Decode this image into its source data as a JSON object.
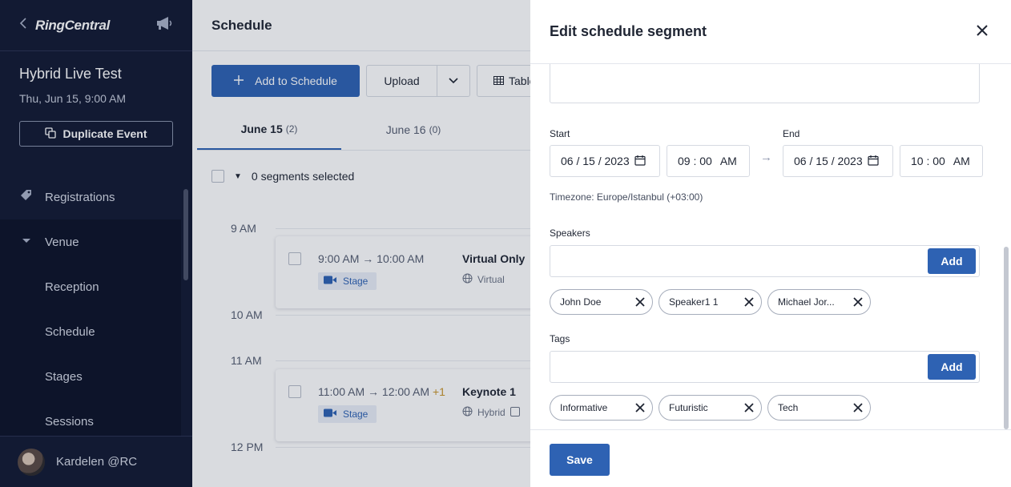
{
  "sidebar": {
    "logo_text": "RingCentral",
    "event_title": "Hybrid Live Test",
    "event_date": "Thu, Jun 15, 9:00 AM",
    "duplicate_label": "Duplicate Event",
    "nav": {
      "registrations": "Registrations",
      "venue": "Venue",
      "reception": "Reception",
      "schedule": "Schedule",
      "stages": "Stages",
      "sessions": "Sessions"
    },
    "user_name": "Kardelen @RC"
  },
  "main": {
    "title": "Schedule",
    "add_label": "Add to Schedule",
    "upload_label": "Upload",
    "table_label": "Table",
    "tabs": [
      {
        "label": "June 15",
        "count": "(2)"
      },
      {
        "label": "June 16",
        "count": "(0)"
      }
    ],
    "selected_text": "0 segments selected",
    "time_labels": [
      "9 AM",
      "10 AM",
      "11 AM",
      "12 PM"
    ],
    "arrow_glyph": "→",
    "segments": [
      {
        "start": "9:00 AM",
        "end": "10:00 AM",
        "plus": "",
        "title": "Virtual Only",
        "stage": "Stage",
        "mode": "Virtual"
      },
      {
        "start": "11:00 AM",
        "end": "12:00 AM",
        "plus": "+1",
        "title": "Keynote 1",
        "stage": "Stage",
        "mode": "Hybrid"
      }
    ]
  },
  "panel": {
    "title": "Edit schedule segment",
    "start_label": "Start",
    "end_label": "End",
    "start_date": "06 / 15 / 2023",
    "start_time": "09 : 00",
    "start_ampm": "AM",
    "end_date": "06 / 15 / 2023",
    "end_time": "10 : 00",
    "end_ampm": "AM",
    "arrow": "→",
    "timezone": "Timezone: Europe/Istanbul (+03:00)",
    "speakers_label": "Speakers",
    "speakers": [
      "John Doe",
      "Speaker1 1",
      "Michael Jor..."
    ],
    "tags_label": "Tags",
    "tags": [
      "Informative",
      "Futuristic",
      "Tech"
    ],
    "add_label": "Add",
    "save_label": "Save"
  },
  "colors": {
    "sidebar_bg": "#131a33",
    "primary": "#2e62b3",
    "accent_plus": "#c7942a"
  }
}
